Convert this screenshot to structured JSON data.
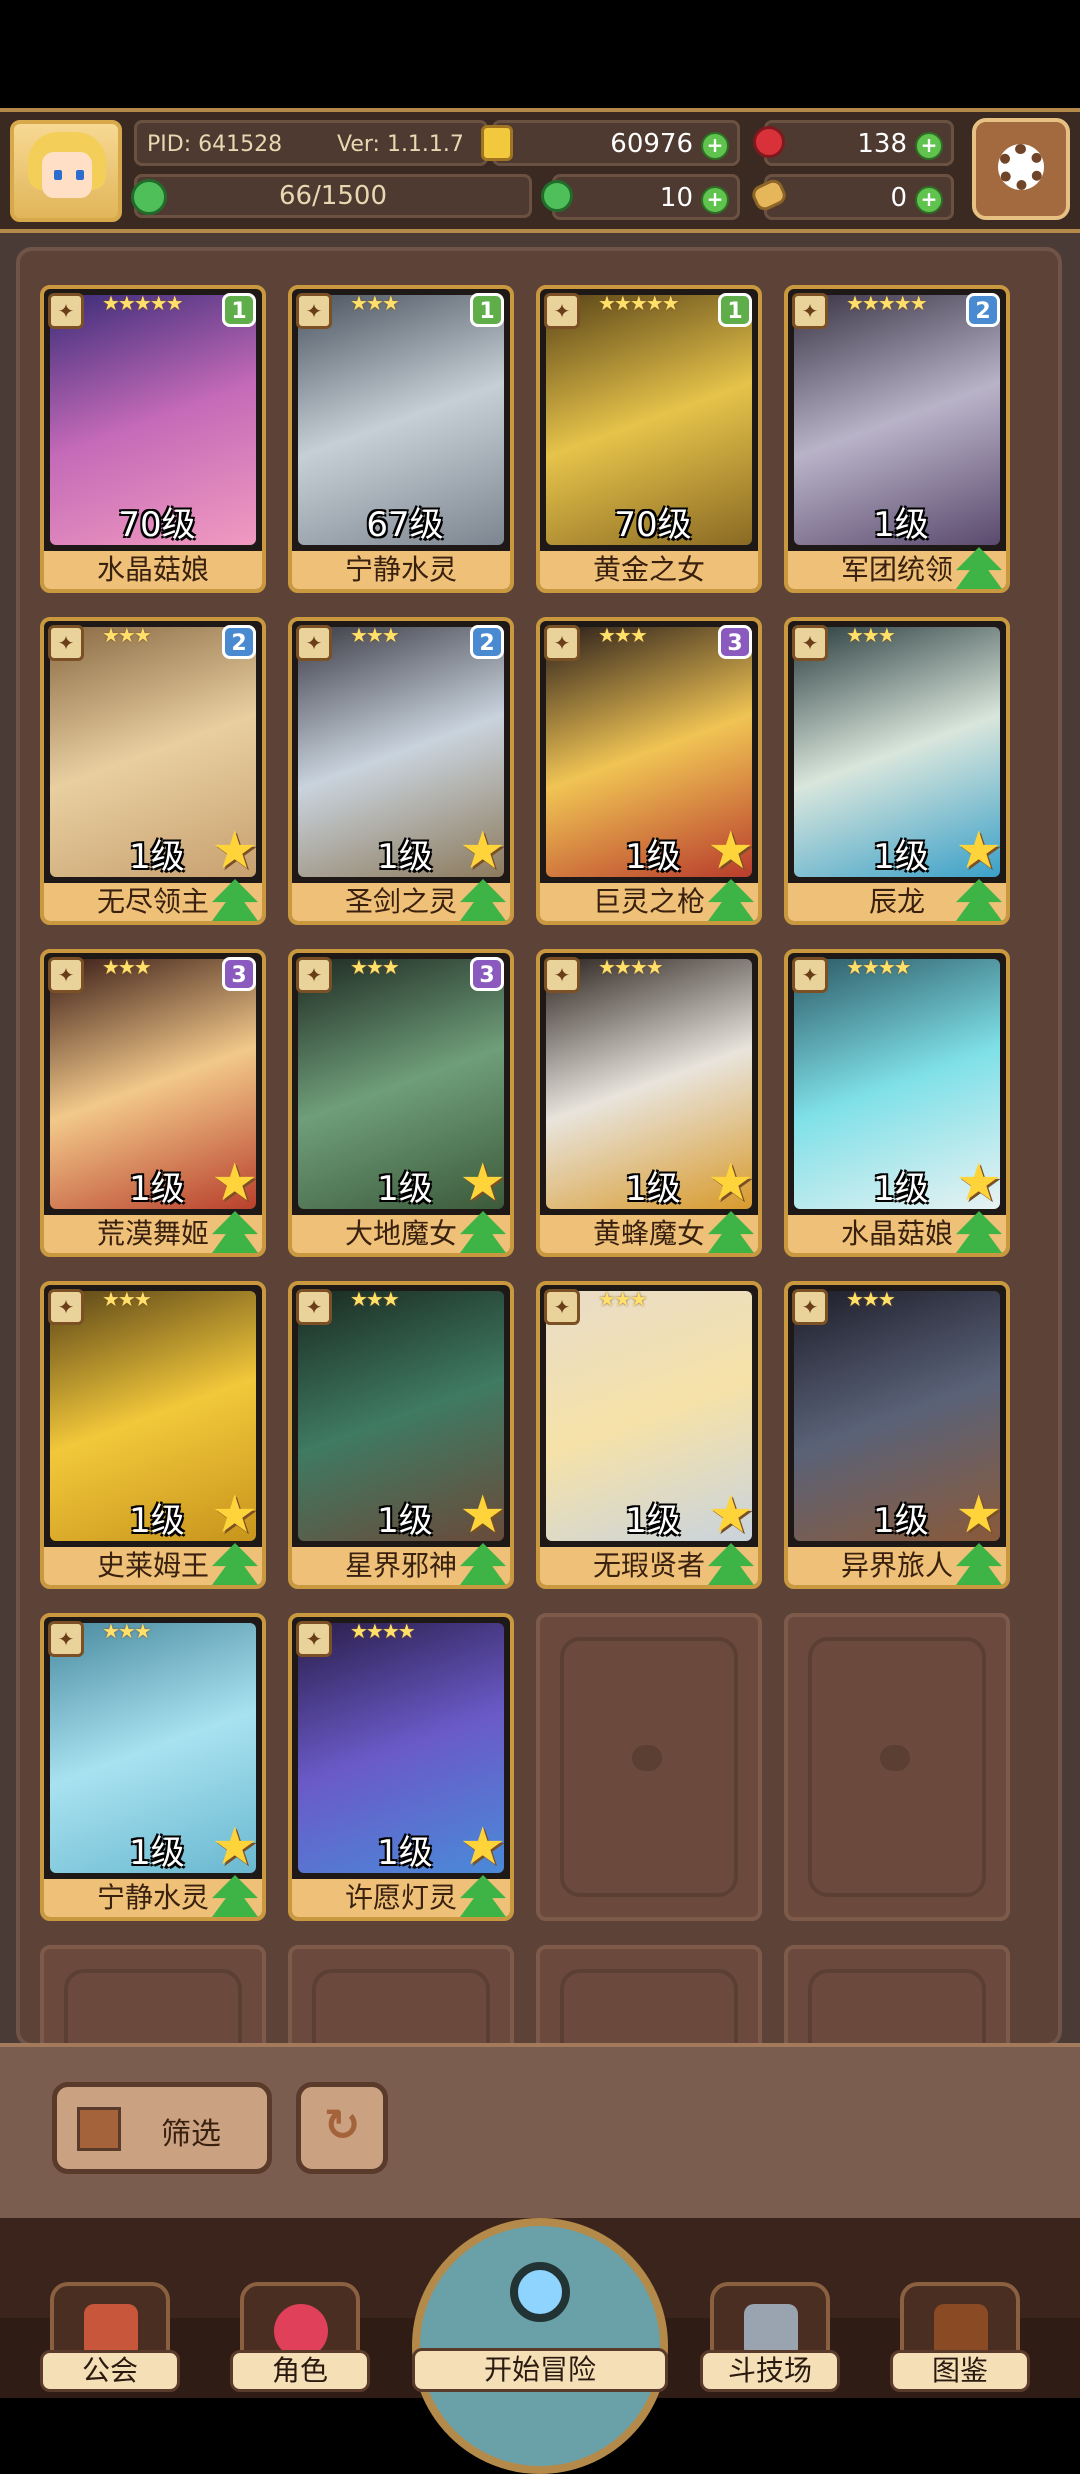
{
  "header": {
    "pid": "PID: 641528",
    "version": "Ver: 1.1.1.7",
    "gold": "60976",
    "ruby": "138",
    "clover": "10",
    "bone": "0",
    "exp": "66/1500"
  },
  "cards": [
    {
      "stars": "★★★★★",
      "badge": "1",
      "level": "70级",
      "name": "水晶菇娘",
      "badge_color": "#5fae4a",
      "art": "linear-gradient(160deg,#3a2c78,#c46ab8,#f19ac0)"
    },
    {
      "stars": "★★★",
      "badge": "1",
      "level": "67级",
      "name": "宁静水灵",
      "badge_color": "#5fae4a",
      "art": "linear-gradient(160deg,#4b5560,#c7cfd6,#7d8590)"
    },
    {
      "stars": "★★★★★",
      "badge": "1",
      "level": "70级",
      "name": "黄金之女",
      "badge_color": "#5fae4a",
      "art": "linear-gradient(160deg,#5a4418,#e6c34a,#8a6a24)"
    },
    {
      "stars": "★★★★★",
      "badge": "2",
      "level": "1级",
      "name": "军团统领",
      "badge_color": "#4a8ad0",
      "art": "linear-gradient(160deg,#3a3446,#b9b3c8,#5b4a6e)"
    },
    {
      "stars": "★★★",
      "badge": "2",
      "level": "1级",
      "name": "无尽领主",
      "badge_color": "#4a8ad0",
      "art": "linear-gradient(160deg,#8a6a44,#e8cfa0,#c8a070)"
    },
    {
      "stars": "★★★",
      "badge": "2",
      "level": "1级",
      "name": "圣剑之灵",
      "badge_color": "#4a8ad0",
      "art": "linear-gradient(160deg,#3c3c46,#c9d3dd,#8c7a5c)"
    },
    {
      "stars": "★★★",
      "badge": "3",
      "level": "1级",
      "name": "巨灵之枪",
      "badge_color": "#8a5abf",
      "art": "linear-gradient(160deg,#2a1e1a,#f0c454,#b83c2c)"
    },
    {
      "stars": "★★★",
      "badge": "",
      "level": "1级",
      "name": "辰龙",
      "badge_color": "",
      "art": "linear-gradient(160deg,#2c3e40,#d9e6dc,#3aa0c8)"
    },
    {
      "stars": "★★★",
      "badge": "3",
      "level": "1级",
      "name": "荒漠舞姬",
      "badge_color": "#8a5abf",
      "art": "linear-gradient(160deg,#3a1c16,#f2c88a,#b8402c)"
    },
    {
      "stars": "★★★",
      "badge": "3",
      "level": "1级",
      "name": "大地魔女",
      "badge_color": "#8a5abf",
      "art": "linear-gradient(160deg,#1e2a22,#6f9e7a,#3c5a3a)"
    },
    {
      "stars": "★★★★",
      "badge": "",
      "level": "1级",
      "name": "黄蜂魔女",
      "badge_color": "",
      "art": "linear-gradient(160deg,#2c2420,#e8e4dc,#d89a2c)"
    },
    {
      "stars": "★★★★",
      "badge": "",
      "level": "1级",
      "name": "水晶菇娘",
      "badge_color": "",
      "art": "linear-gradient(160deg,#2c5a66,#7fe0e8,#e8f2f2)"
    },
    {
      "stars": "★★★",
      "badge": "",
      "level": "1级",
      "name": "史莱姆王",
      "badge_color": "",
      "art": "linear-gradient(160deg,#5a4418,#f2c83a,#c8941c)"
    },
    {
      "stars": "★★★",
      "badge": "",
      "level": "1级",
      "name": "星界邪神",
      "badge_color": "",
      "art": "linear-gradient(160deg,#1a2a22,#3f7a62,#6a4a3a)"
    },
    {
      "stars": "★★★",
      "badge": "",
      "level": "1级",
      "name": "无瑕贤者",
      "badge_color": "",
      "art": "linear-gradient(160deg,#e8dcc8,#f6e2a8,#c9d3dd)"
    },
    {
      "stars": "★★★",
      "badge": "",
      "level": "1级",
      "name": "异界旅人",
      "badge_color": "",
      "art": "linear-gradient(160deg,#1e1e2a,#5a6278,#8a5a3a)"
    },
    {
      "stars": "★★★",
      "badge": "",
      "level": "1级",
      "name": "宁静水灵",
      "badge_color": "",
      "art": "linear-gradient(160deg,#4a8aa0,#a8e2f0,#6ab8d0)"
    },
    {
      "stars": "★★★★",
      "badge": "",
      "level": "1级",
      "name": "许愿灯灵",
      "badge_color": "",
      "art": "linear-gradient(160deg,#2a1e4a,#6a5ac8,#4a8ad8)"
    }
  ],
  "buttons": {
    "filter": "筛选",
    "refresh": "↻"
  },
  "nav": {
    "guild": "公会",
    "character": "角色",
    "adventure": "开始冒险",
    "arena": "斗技场",
    "codex": "图鉴"
  }
}
